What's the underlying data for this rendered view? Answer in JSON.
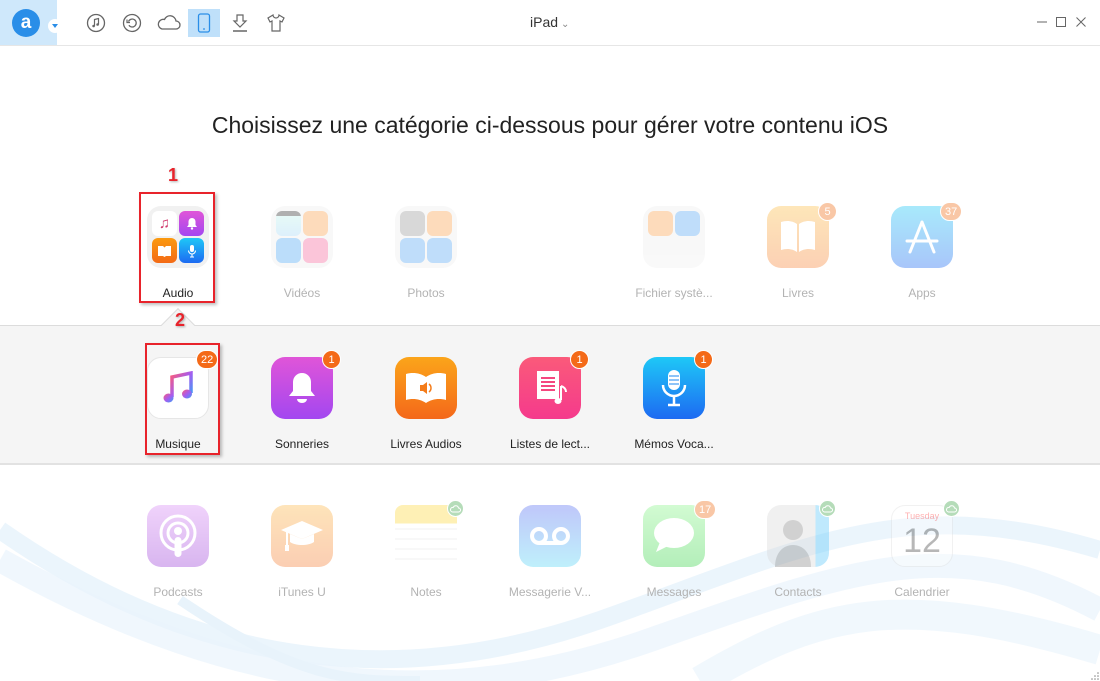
{
  "titlebar": {
    "logo_letter": "a",
    "device_name": "iPad",
    "toolbar": [
      {
        "name": "music-manager",
        "icon": "music-note-circle-icon"
      },
      {
        "name": "restore",
        "icon": "restore-icon"
      },
      {
        "name": "icloud",
        "icon": "cloud-icon"
      },
      {
        "name": "device",
        "icon": "phone-icon",
        "active": true
      },
      {
        "name": "download",
        "icon": "download-icon"
      },
      {
        "name": "toolkit",
        "icon": "tshirt-icon"
      }
    ],
    "window_controls": [
      "minimize",
      "maximize",
      "close"
    ]
  },
  "heading": "Choisissez une catégorie ci-dessous pour gérer votre contenu iOS",
  "top_row": [
    {
      "label": "Audio",
      "selected": true
    },
    {
      "label": "Vidéos"
    },
    {
      "label": "Photos"
    },
    {
      "label": "Fichier systè..."
    },
    {
      "label": "Livres",
      "badge": "5"
    },
    {
      "label": "Apps",
      "badge": "37"
    }
  ],
  "audio_row": [
    {
      "label": "Musique",
      "badge": "22"
    },
    {
      "label": "Sonneries",
      "badge": "1"
    },
    {
      "label": "Livres Audios"
    },
    {
      "label": "Listes de lect...",
      "badge": "1"
    },
    {
      "label": "Mémos Voca...",
      "badge": "1"
    }
  ],
  "bottom_row": [
    {
      "label": "Podcasts"
    },
    {
      "label": "iTunes U"
    },
    {
      "label": "Notes",
      "cloud": true
    },
    {
      "label": "Messagerie V..."
    },
    {
      "label": "Messages",
      "badge": "17"
    },
    {
      "label": "Contacts",
      "cloud": true
    },
    {
      "label": "Calendrier",
      "cloud": true,
      "calendar_day": "Tuesday",
      "calendar_date": "12"
    }
  ],
  "annotations": [
    "1",
    "2"
  ],
  "colors": {
    "accent": "#2a8ee8",
    "badge": "#f46a18",
    "annotation": "#e8232b"
  }
}
